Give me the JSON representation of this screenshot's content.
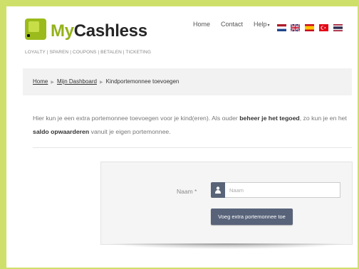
{
  "brand": {
    "name_part1": "My",
    "name_part2": "Cashless",
    "tagline": "LOYALTY | SPAREN | COUPONS | BETALEN | TICKETING",
    "accent_color": "#93b21b",
    "frame_color": "#cfe06a"
  },
  "topnav": {
    "home": "Home",
    "contact": "Contact",
    "help": "Help",
    "help_caret": "▾",
    "languages": [
      "nl",
      "gb",
      "es",
      "tr",
      "th"
    ]
  },
  "breadcrumb": {
    "items": [
      "Home",
      "Mijn Dashboard",
      "Kindportemonnee toevoegen"
    ],
    "separator": "▶"
  },
  "intro": {
    "part1": "Hier kun je een extra portemonnee toevoegen voor je kind(eren). Als ouder ",
    "bold1": "beheer je het tegoed",
    "part2": ", zo kun je en het ",
    "bold2": "saldo opwaarderen",
    "part3": " vanuit je eigen portemonnee."
  },
  "form": {
    "naam_label": "Naam *",
    "naam_placeholder": "Naam",
    "naam_value": "",
    "user_icon": "user-icon",
    "submit_label": "Voeg extra portemonnee toe"
  }
}
